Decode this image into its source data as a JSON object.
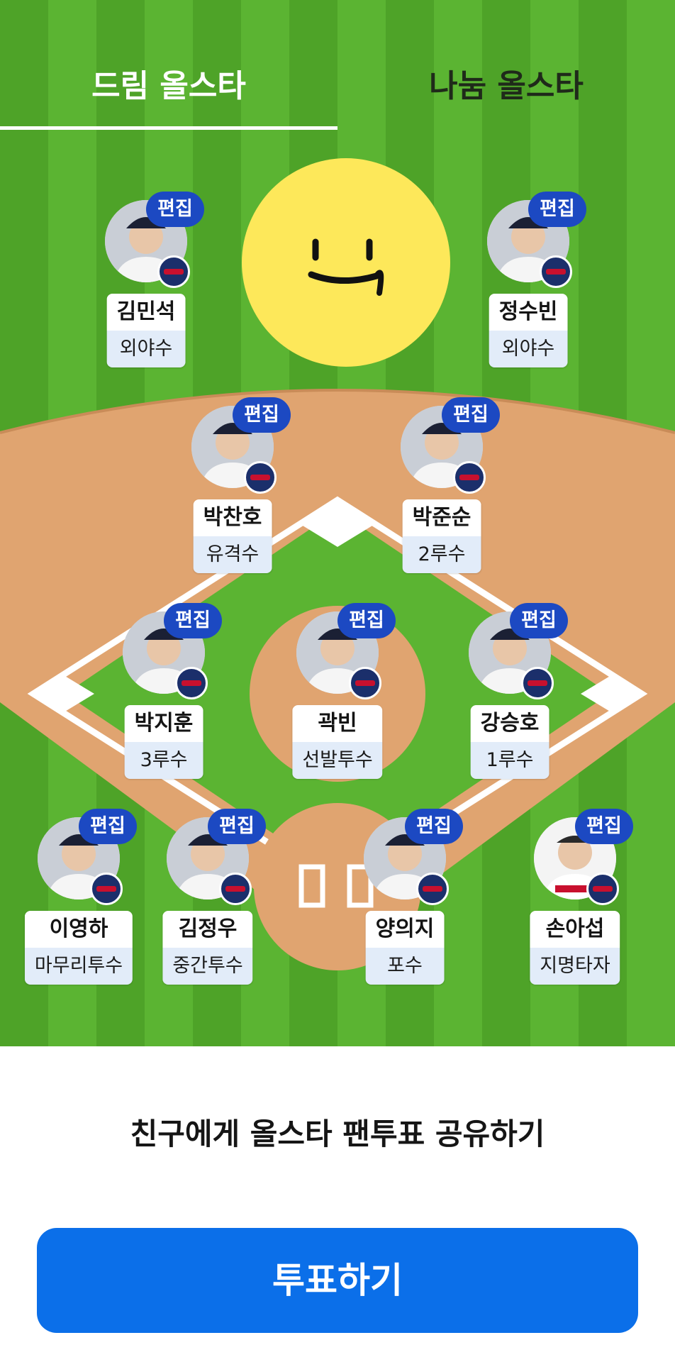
{
  "tabs": [
    {
      "label": "드림 올스타",
      "active": true
    },
    {
      "label": "나눔 올스타",
      "active": false
    }
  ],
  "edit_label": "편집",
  "players": [
    {
      "name": "김민석",
      "position": "외야수"
    },
    {
      "name": "정수빈",
      "position": "외야수"
    },
    {
      "name": "박찬호",
      "position": "유격수"
    },
    {
      "name": "박준순",
      "position": "2루수"
    },
    {
      "name": "박지훈",
      "position": "3루수"
    },
    {
      "name": "곽빈",
      "position": "선발투수"
    },
    {
      "name": "강승호",
      "position": "1루수"
    },
    {
      "name": "이영하",
      "position": "마무리투수"
    },
    {
      "name": "김정우",
      "position": "중간투수"
    },
    {
      "name": "양의지",
      "position": "포수"
    },
    {
      "name": "손아섭",
      "position": "지명타자"
    }
  ],
  "share_text": "친구에게 올스타 팬투표 공유하기",
  "vote_button": "투표하기",
  "colors": {
    "field_green": "#4ea328",
    "infield_dirt": "#e0a470",
    "edit_badge": "#1c49c2",
    "vote_button": "#0b6fe9",
    "emoji_yellow": "#fde85a"
  }
}
